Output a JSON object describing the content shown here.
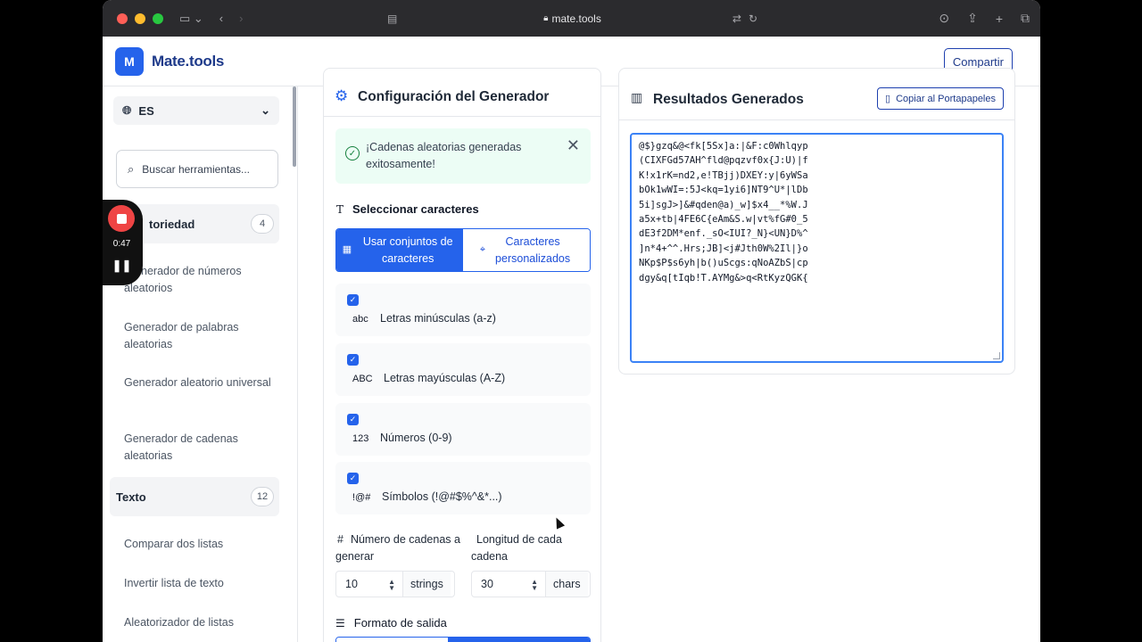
{
  "browser": {
    "url": "mate.tools",
    "colors": {
      "close": "#ff5f57",
      "minimize": "#febc2e",
      "maximize": "#28c840"
    }
  },
  "header": {
    "logo_letter": "M",
    "brand": "Mate.tools",
    "share_label": "Compartir"
  },
  "recorder": {
    "time": "0:47"
  },
  "sidebar": {
    "language": "ES",
    "search_placeholder": "Buscar herramientas...",
    "categories": [
      {
        "label": "Aleatoriedad",
        "visible_label": "toriedad",
        "count": "4"
      },
      {
        "label": "Texto",
        "count": "12"
      }
    ],
    "items": [
      "Generador de números aleatorios",
      "Generador de palabras aleatorias",
      "Generador aleatorio universal",
      "Generador de cadenas aleatorias",
      "Comparar dos listas",
      "Invertir lista de texto",
      "Aleatorizador de listas"
    ],
    "items_visible": [
      "nerador de números",
      "aleatorios"
    ]
  },
  "config": {
    "title": "Configuración del Generador",
    "alert_text": "¡Cadenas aleatorias generadas exitosamente!",
    "select_chars_title": "Seleccionar caracteres",
    "tab_sets": "Usar conjuntos de caracteres",
    "tab_custom": "Caracteres personalizados",
    "options": [
      {
        "code": "abc",
        "label": "Letras minúsculas (a-z)"
      },
      {
        "code": "ABC",
        "label": "Letras mayúsculas (A-Z)"
      },
      {
        "code": "123",
        "label": "Números (0-9)"
      },
      {
        "code": "!@#",
        "label": "Símbolos (!@#$%^&*...)"
      }
    ],
    "count_label": "Número de cadenas a generar",
    "count_value": "10",
    "count_unit": "strings",
    "length_label": "Longitud de cada cadena",
    "length_value": "30",
    "length_unit": "chars",
    "format_title": "Formato de salida"
  },
  "results": {
    "title": "Resultados Generados",
    "copy_label": "Copiar al Portapapeles",
    "output_lines": [
      "@$}gzq&@<fk[5Sx]a:|&F:c0Whlqyp",
      "(CIXFGd57AH^fld@pqzvf0x{J:U)|f",
      "K!x1rK=nd2,e!TBjj)DXEY:y|6yWSa",
      "bOk1wWI=:5J<kq=1yi6]NT9^U*|lDb",
      "5i]sgJ>]&#qden@a)_w]$x4__*%W.J",
      "a5x+tb|4FE6C{eAm&S.w|vt%fG#0_5",
      "dE3f2DM*enf._sO<IUI?_N}<UN}D%^",
      "]n*4+^^.Hrs;JB]<j#Jth0W%2Il|}o",
      "NKp$P$s6yh|b()uScgs:qNoAZbS|cp",
      "dgy&q[tIqb!T.AYMg&>q<RtKyzQGK{"
    ]
  }
}
